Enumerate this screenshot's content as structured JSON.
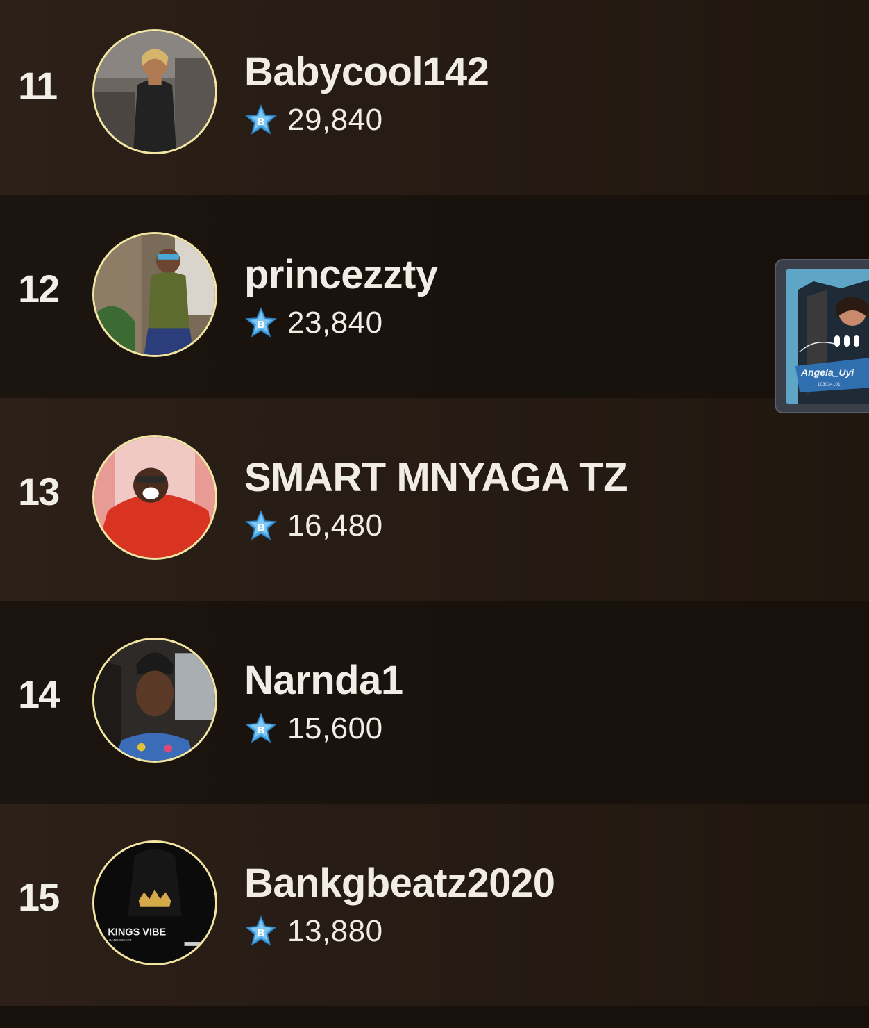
{
  "leaderboard": {
    "rows": [
      {
        "rank": "11",
        "name": "Babycool142",
        "score": "29,840",
        "avatar": "woman-black-leather-dress"
      },
      {
        "rank": "12",
        "name": "princezzty",
        "score": "23,840",
        "avatar": "woman-green-outfit-sunglasses"
      },
      {
        "rank": "13",
        "name": "SMART MNYAGA TZ",
        "score": "16,480",
        "avatar": "man-red-scarf-laughing"
      },
      {
        "rank": "14",
        "name": "Narnda1",
        "score": "15,600",
        "avatar": "woman-car-selfie"
      },
      {
        "rank": "15",
        "name": "Bankgbeatz2020",
        "score": "13,880",
        "avatar": "kings-vibe-crown-logo"
      }
    ],
    "score_icon": "star-b-icon",
    "colors": {
      "text": "#f1ede6",
      "avatar_ring": "#f3e6a4",
      "star": "#4aa8e8"
    }
  },
  "floating_live": {
    "name": "Angela_Uyi",
    "sub_id": "103034101",
    "logo_text": "KINGS VIBE",
    "logo_sub": "BANKGBEATZ"
  }
}
